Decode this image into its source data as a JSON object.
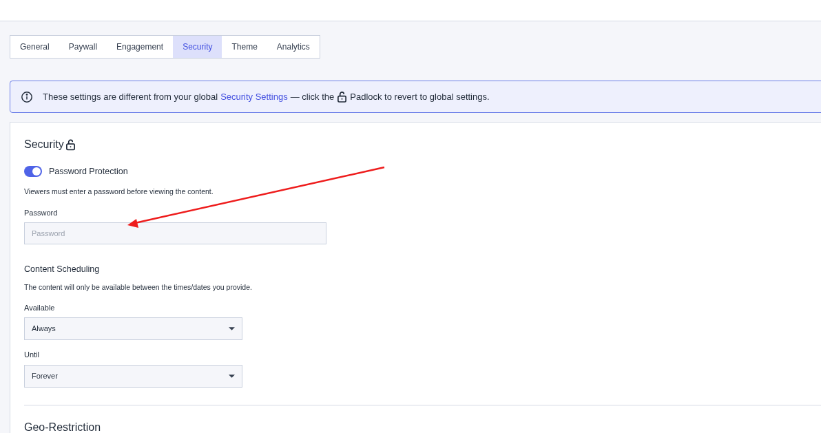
{
  "tabs": [
    {
      "label": "General",
      "selected": false
    },
    {
      "label": "Paywall",
      "selected": false
    },
    {
      "label": "Engagement",
      "selected": false
    },
    {
      "label": "Security",
      "selected": true
    },
    {
      "label": "Theme",
      "selected": false
    },
    {
      "label": "Analytics",
      "selected": false
    }
  ],
  "banner": {
    "text_before": "These settings are different from your global",
    "link": "Security Settings",
    "text_middle": "— click the",
    "text_after": "Padlock to revert to global settings."
  },
  "section": {
    "title": "Security",
    "locked": false
  },
  "password_protection": {
    "label": "Password Protection",
    "on": true,
    "description": "Viewers must enter a password before viewing the content.",
    "field_label": "Password",
    "placeholder": "Password"
  },
  "scheduling": {
    "title": "Content Scheduling",
    "description": "The content will only be available between the times/dates you provide.",
    "fields": [
      {
        "label": "Available",
        "value": "Always"
      },
      {
        "label": "Until",
        "value": "Forever"
      }
    ]
  },
  "geo": {
    "title": "Geo-Restriction"
  },
  "annotation": {
    "kind": "arrow"
  }
}
